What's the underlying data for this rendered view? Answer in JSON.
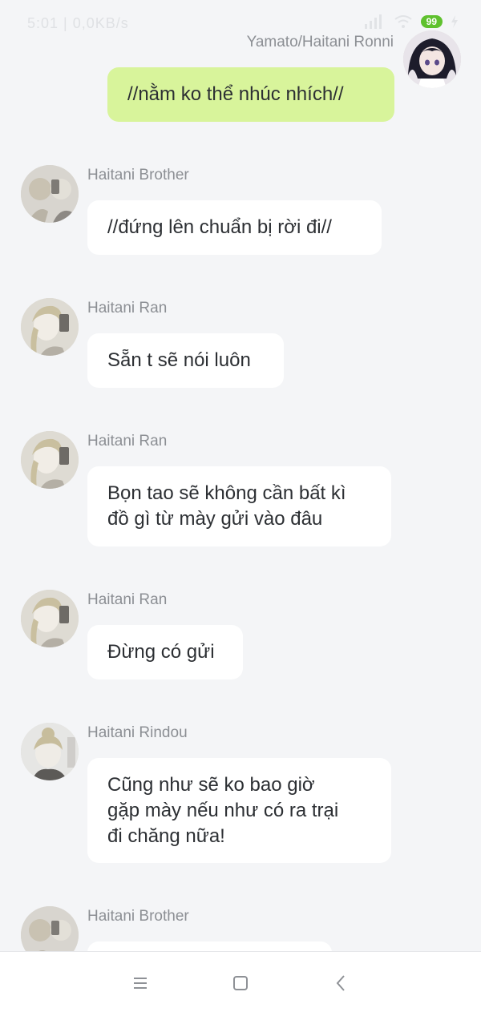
{
  "status_bar": {
    "time_and_speed": "5:01 | 0,0KB/s",
    "battery_level": "99"
  },
  "messages": [
    {
      "side": "mine",
      "sender": "Yamato/Haitani Ronni",
      "text": "//nằm ko thể nhúc nhích//"
    },
    {
      "side": "theirs",
      "sender": "Haitani Brother",
      "text": "//đứng lên chuẩn bị rời đi//"
    },
    {
      "side": "theirs",
      "sender": "Haitani Ran",
      "text": "Sẵn t sẽ nói luôn"
    },
    {
      "side": "theirs",
      "sender": "Haitani Ran",
      "lines": [
        "Bọn tao sẽ không cần bất kì",
        "đồ gì từ mày gửi vào đâu"
      ]
    },
    {
      "side": "theirs",
      "sender": "Haitani Ran",
      "text": "Đừng có gửi"
    },
    {
      "side": "theirs",
      "sender": "Haitani Rindou",
      "lines": [
        "Cũng như sẽ ko bao giờ",
        "gặp mày nếu như có ra trại",
        "đi chăng nữa!"
      ]
    },
    {
      "side": "theirs",
      "sender": "Haitani Brother",
      "text": ""
    }
  ],
  "colors": {
    "background": "#f4f5f7",
    "my_bubble": "#d8f49b",
    "their_bubble": "#ffffff",
    "sender_text": "#8c8f94"
  },
  "nav_bar": {
    "icons": [
      "menu-icon",
      "home-square-icon",
      "back-chevron-icon"
    ]
  }
}
